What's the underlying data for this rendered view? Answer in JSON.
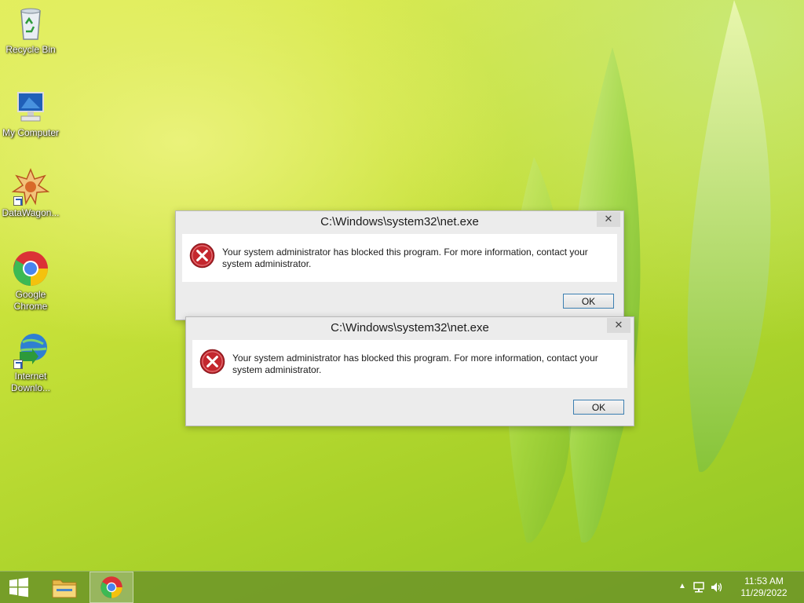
{
  "desktop": {
    "icons": [
      {
        "label": "Recycle Bin",
        "icon": "recycle-bin-icon"
      },
      {
        "label": "My Computer",
        "icon": "computer-icon"
      },
      {
        "label": "DataWagon...",
        "icon": "datawagon-icon"
      },
      {
        "label": "Google Chrome",
        "icon": "chrome-icon"
      },
      {
        "label": "Internet Downlo...",
        "icon": "internet-download-manager-icon"
      }
    ]
  },
  "dialogs": [
    {
      "title": "C:\\Windows\\system32\\net.exe",
      "close": "✕",
      "message": "Your system administrator has blocked this program. For more information, contact your system administrator.",
      "ok_label": "OK"
    },
    {
      "title": "C:\\Windows\\system32\\net.exe",
      "close": "✕",
      "message": "Your system administrator has blocked this program. For more information, contact your system administrator.",
      "ok_label": "OK"
    }
  ],
  "taskbar": {
    "buttons": [
      {
        "icon": "windows-start-icon"
      },
      {
        "icon": "file-explorer-icon"
      },
      {
        "icon": "chrome-icon",
        "active": true
      }
    ],
    "tray": {
      "icons": [
        "show-hidden-icons-chevron-icon",
        "network-icon",
        "volume-icon"
      ],
      "time": "11:53 AM",
      "date": "11/29/2022"
    }
  },
  "colors": {
    "error_red": "#c4272e",
    "ok_border": "#3c7fb1",
    "taskbar": "#6e9628"
  }
}
